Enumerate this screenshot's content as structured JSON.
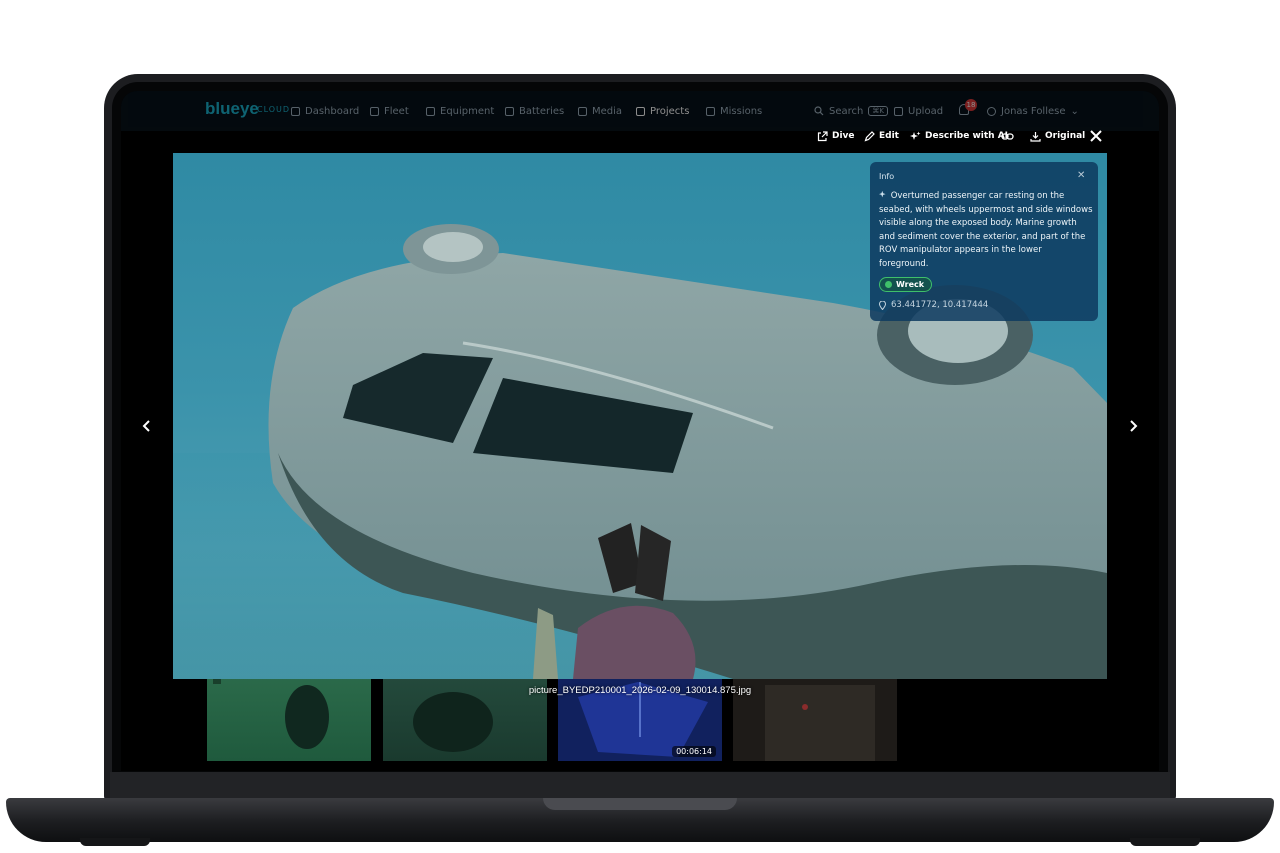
{
  "app": {
    "logo": "blueye",
    "logo_sub": "CLOUD",
    "nav": [
      {
        "label": "Dashboard",
        "icon": "grid-icon"
      },
      {
        "label": "Fleet",
        "icon": "drone-icon"
      },
      {
        "label": "Equipment",
        "icon": "plug-icon"
      },
      {
        "label": "Batteries",
        "icon": "battery-icon"
      },
      {
        "label": "Media",
        "icon": "media-icon"
      },
      {
        "label": "Projects",
        "icon": "folder-icon",
        "active": true
      },
      {
        "label": "Missions",
        "icon": "route-icon"
      }
    ],
    "search_label": "Search",
    "search_shortcut": "⌘K",
    "upload_label": "Upload",
    "notification_count": "18",
    "user_name": "Jonas Follese"
  },
  "toolbar": {
    "dive_label": "Dive",
    "edit_label": "Edit",
    "describe_label": "Describe with AI",
    "original_label": "Original"
  },
  "info": {
    "title": "Info",
    "description": "Overturned passenger car resting on the seabed, with wheels uppermost and side windows visible along the exposed body. Marine growth and sediment cover the exterior, and part of the ROV manipulator appears in the lower foreground.",
    "tag": "Wreck",
    "coordinates": "63.441772, 10.417444"
  },
  "filmstrip": {
    "filename": "picture_BYEDP210001_2026-02-09_130014.875.jpg",
    "video_duration": "00:06:14"
  },
  "colors": {
    "accent": "#1bb4d0",
    "info_panel": "#0e3a60",
    "tag_green": "#3fbf6a",
    "notification_red": "#e03b3b"
  }
}
